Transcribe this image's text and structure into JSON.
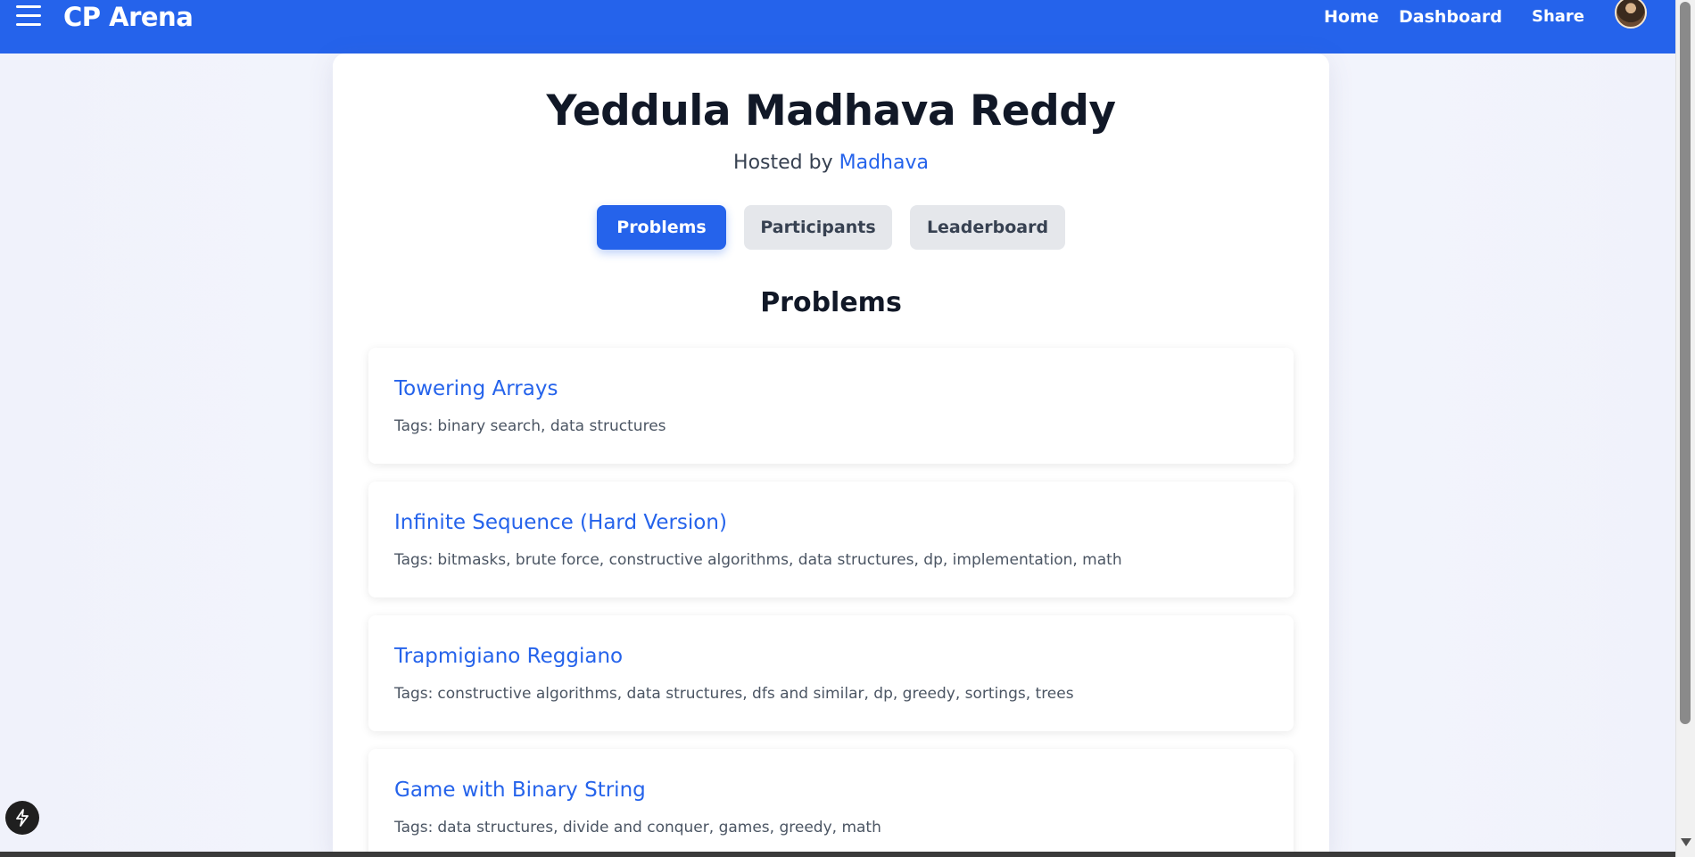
{
  "navbar": {
    "brand": "CP Arena",
    "links": [
      "Home",
      "Dashboard",
      "Share"
    ]
  },
  "contest": {
    "title": "Yeddula Madhava Reddy",
    "hosted_prefix": "Hosted by",
    "host": "Madhava"
  },
  "tabs": [
    {
      "label": "Problems",
      "active": true
    },
    {
      "label": "Participants",
      "active": false
    },
    {
      "label": "Leaderboard",
      "active": false
    }
  ],
  "section_title": "Problems",
  "tags_label": "Tags:",
  "problems": [
    {
      "title": "Towering Arrays",
      "tags": "binary search, data structures"
    },
    {
      "title": "Infinite Sequence (Hard Version)",
      "tags": "bitmasks, brute force, constructive algorithms, data structures, dp, implementation, math"
    },
    {
      "title": "Trapmigiano Reggiano",
      "tags": "constructive algorithms, data structures, dfs and similar, dp, greedy, sortings, trees"
    },
    {
      "title": "Game with Binary String",
      "tags": "data structures, divide and conquer, games, greedy, math"
    }
  ],
  "colors": {
    "primary": "#2563eb",
    "text_dark": "#111827",
    "tab_inactive": "#e5e7eb"
  }
}
